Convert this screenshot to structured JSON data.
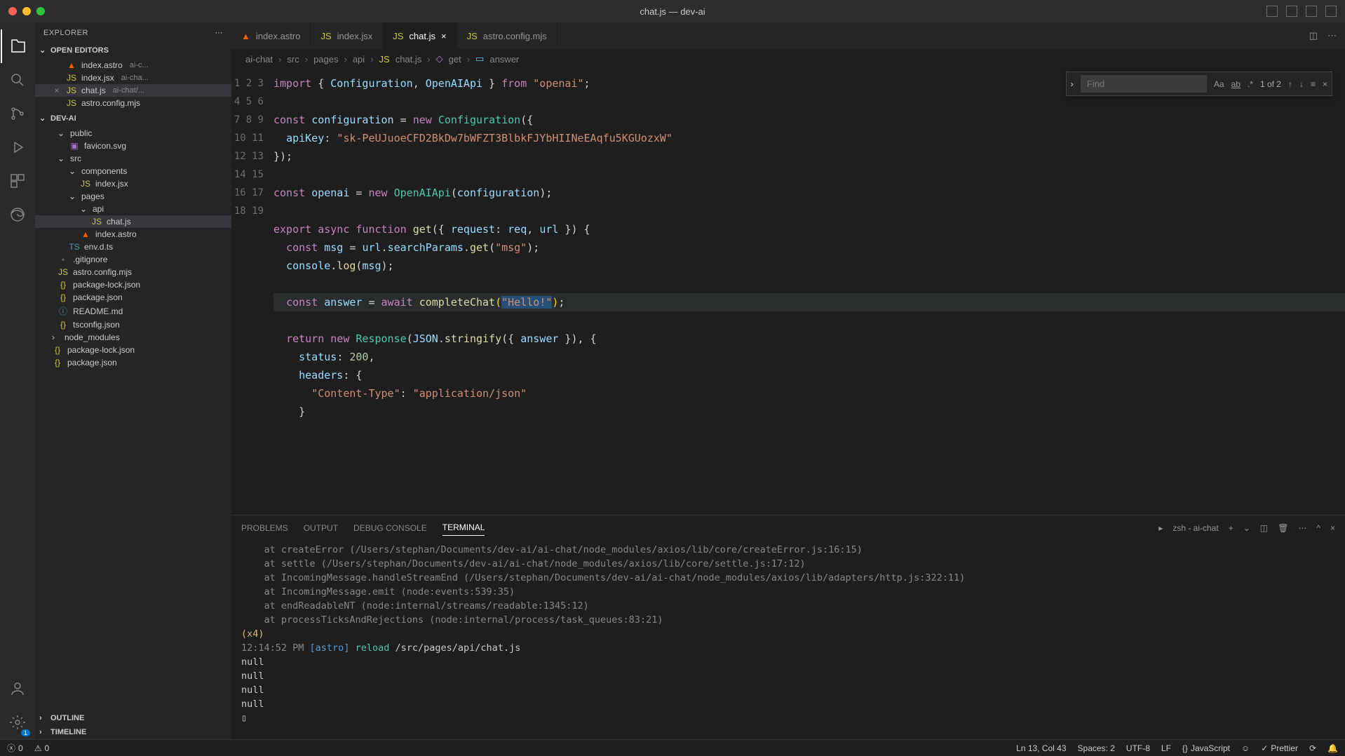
{
  "title": "chat.js — dev-ai",
  "explorer_label": "EXPLORER",
  "sections": {
    "open_editors": "OPEN EDITORS",
    "project": "DEV-AI",
    "outline": "OUTLINE",
    "timeline": "TIMELINE"
  },
  "open_editors": [
    {
      "name": "index.astro",
      "meta": "ai-c...",
      "icon": "astro"
    },
    {
      "name": "index.jsx",
      "meta": "ai-cha...",
      "icon": "jsx"
    },
    {
      "name": "chat.js",
      "meta": "ai-chat/...",
      "icon": "js",
      "active": true
    },
    {
      "name": "astro.config.mjs",
      "meta": "",
      "icon": "js"
    }
  ],
  "tree": {
    "public": "public",
    "favicon": "favicon.svg",
    "src": "src",
    "components": "components",
    "index_jsx": "index.jsx",
    "pages": "pages",
    "api": "api",
    "chat_js": "chat.js",
    "index_astro": "index.astro",
    "env": "env.d.ts",
    "gitignore": ".gitignore",
    "astro_config": "astro.config.mjs",
    "pkg_lock": "package-lock.json",
    "pkg": "package.json",
    "readme": "README.md",
    "tsconfig": "tsconfig.json",
    "node_modules": "node_modules",
    "pkg_lock2": "package-lock.json",
    "pkg2": "package.json"
  },
  "tabs": [
    {
      "label": "index.astro",
      "icon": "astro"
    },
    {
      "label": "index.jsx",
      "icon": "jsx"
    },
    {
      "label": "chat.js",
      "icon": "js",
      "active": true,
      "close": true
    },
    {
      "label": "astro.config.mjs",
      "icon": "js"
    }
  ],
  "breadcrumb": [
    "ai-chat",
    "src",
    "pages",
    "api",
    "chat.js",
    "get",
    "answer"
  ],
  "find": {
    "placeholder": "Find",
    "count": "1 of 2"
  },
  "code": {
    "l1_import": "import",
    "l1_cfg": "Configuration",
    "l1_api": "OpenAIApi",
    "l1_from": "from",
    "l1_mod": "\"openai\"",
    "l3_const": "const",
    "l3_var": "configuration",
    "l3_new": "new",
    "l3_ctor": "Configuration",
    "l4_key": "apiKey",
    "l4_val": "\"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\"",
    "l7_var": "openai",
    "l7_ctor": "OpenAIApi",
    "l7_arg": "configuration",
    "l9_export": "export",
    "l9_async": "async",
    "l9_func": "function",
    "l9_name": "get",
    "l9_req": "request",
    "l9_reqa": "req",
    "l9_url": "url",
    "l10_msg": "msg",
    "l10_url": "url",
    "l10_sp": "searchParams",
    "l10_get": "get",
    "l10_arg": "\"msg\"",
    "l11_console": "console",
    "l11_log": "log",
    "l13_ans": "answer",
    "l13_await": "await",
    "l13_fn": "completeChat",
    "l13_str": "\"Hello!\"",
    "l15_return": "return",
    "l15_resp": "Response",
    "l15_json": "JSON",
    "l15_strfy": "stringify",
    "l16_status": "status",
    "l16_200": "200",
    "l17_headers": "headers",
    "l18_ct": "\"Content-Type\"",
    "l18_aj": "\"application/json\""
  },
  "panel_tabs": {
    "problems": "PROBLEMS",
    "output": "OUTPUT",
    "debug": "DEBUG CONSOLE",
    "terminal": "TERMINAL"
  },
  "terminal_label": "zsh - ai-chat",
  "terminal_lines": [
    "    at createError (/Users/stephan/Documents/dev-ai/ai-chat/node_modules/axios/lib/core/createError.js:16:15)",
    "    at settle (/Users/stephan/Documents/dev-ai/ai-chat/node_modules/axios/lib/core/settle.js:17:12)",
    "    at IncomingMessage.handleStreamEnd (/Users/stephan/Documents/dev-ai/ai-chat/node_modules/axios/lib/adapters/http.js:322:11)",
    "    at IncomingMessage.emit (node:events:539:35)",
    "    at endReadableNT (node:internal/streams/readable:1345:12)",
    "    at processTicksAndRejections (node:internal/process/task_queues:83:21)"
  ],
  "terminal_x4": "(x4)",
  "terminal_ts": "12:14:52 PM",
  "terminal_astro": "[astro]",
  "terminal_reload": "reload",
  "terminal_path": "/src/pages/api/chat.js",
  "terminal_null": "null",
  "statusbar": {
    "errors": "0",
    "warnings": "0",
    "lncol": "Ln 13, Col 43",
    "spaces": "Spaces: 2",
    "encoding": "UTF-8",
    "eol": "LF",
    "lang": "JavaScript",
    "prettier": "Prettier"
  },
  "settings_badge": "1"
}
